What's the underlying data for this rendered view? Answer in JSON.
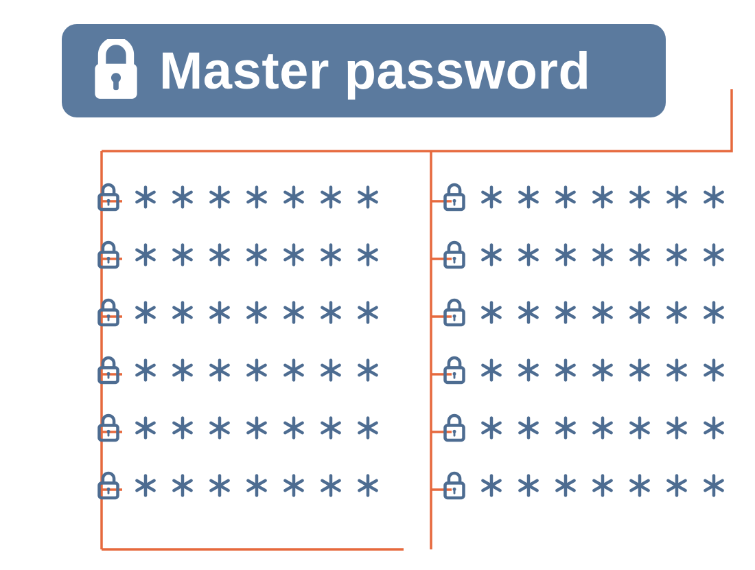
{
  "colors": {
    "box_fill": "#5b7a9e",
    "icon_stroke": "#4d6c91",
    "connector": "#e6693d",
    "text": "#ffffff"
  },
  "master": {
    "label": "Master password"
  },
  "password_mask_char": "*",
  "mask_length": 7,
  "columns": {
    "left_items": 6,
    "right_items": 6
  }
}
